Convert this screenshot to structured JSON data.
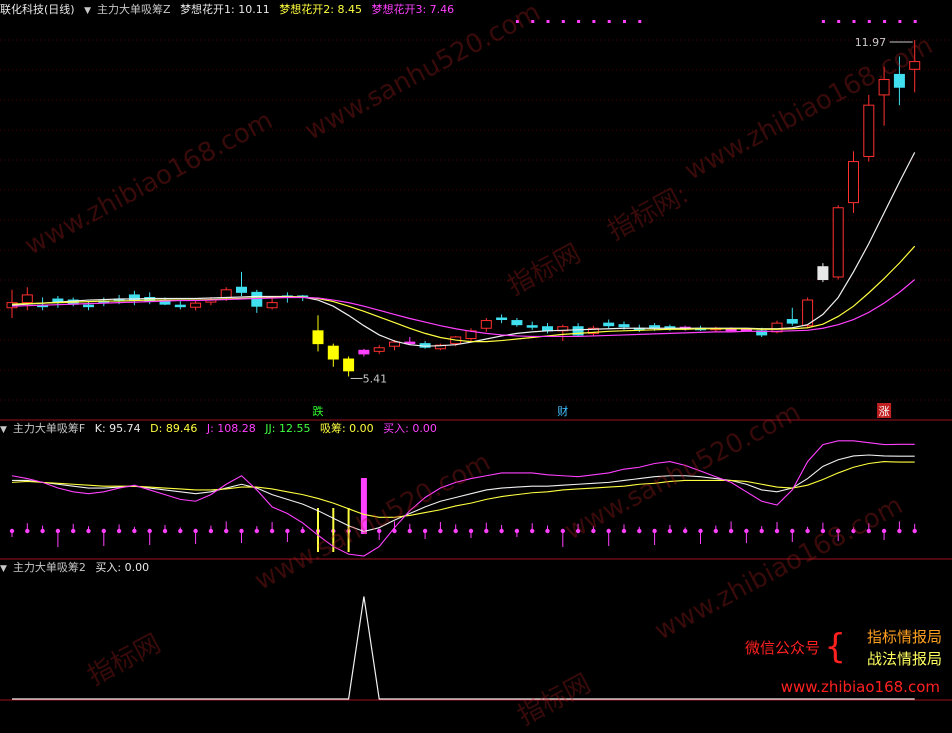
{
  "title_bar": {
    "stock": "联化科技(日线)",
    "indicator": "主力大单吸筹Z",
    "lines": [
      {
        "label": "梦想花开1: 10.11",
        "color": "#e8e8e8"
      },
      {
        "label": "梦想花开2: 8.45",
        "color": "#ffff40"
      },
      {
        "label": "梦想花开3: 7.46",
        "color": "#ff40ff"
      }
    ]
  },
  "pane2_title": {
    "indicator": "主力大单吸筹F",
    "items": [
      {
        "label": "K: 95.74",
        "color": "#e8e8e8"
      },
      {
        "label": "D: 89.46",
        "color": "#ffff40"
      },
      {
        "label": "J: 108.28",
        "color": "#ff40ff"
      },
      {
        "label": "JJ: 12.55",
        "color": "#40ff40"
      },
      {
        "label": "吸筹: 0.00",
        "color": "#ffff40"
      },
      {
        "label": "买入: 0.00",
        "color": "#ff40ff"
      }
    ]
  },
  "pane3_title": {
    "indicator": "主力大单吸筹2",
    "items": [
      {
        "label": "买入: 0.00",
        "color": "#e8e8e8"
      }
    ]
  },
  "promo": {
    "left": "微信公众号",
    "line1": "指标情报局",
    "line2": "战法情报局",
    "url": "www.zhibiao168.com"
  },
  "watermarks": [
    "www.zhibiao168.com",
    "www.sanhu520.com",
    "指标网",
    "指标网:",
    "www.zhibiao168.com",
    "www.sanhu520.com",
    "指标网",
    "www.zhibiao168.com",
    "www.sanhu520.com",
    "指标网"
  ],
  "chart_data": [
    {
      "type": "candlestick",
      "title": "主力大单吸筹Z",
      "ylim": [
        4.6,
        12.4
      ],
      "annotations": [
        {
          "text": "11.97",
          "index": 59,
          "value": 11.97
        },
        {
          "text": "5.41",
          "index": 22,
          "value": 5.41
        }
      ],
      "markers": [
        {
          "text": "跌",
          "index": 20,
          "color": "#30ff30"
        },
        {
          "text": "财",
          "index": 36,
          "color": "#40c0ff"
        },
        {
          "text": "涨",
          "index": 57,
          "color": "#ffffff",
          "bg": "#c02020"
        }
      ],
      "candles": [
        {
          "o": 6.75,
          "h": 7.1,
          "l": 6.55,
          "c": 6.85,
          "t": "r"
        },
        {
          "o": 6.85,
          "h": 7.15,
          "l": 6.7,
          "c": 7.0,
          "t": "r"
        },
        {
          "o": 6.8,
          "h": 6.95,
          "l": 6.7,
          "c": 6.8,
          "t": "c"
        },
        {
          "o": 6.85,
          "h": 6.98,
          "l": 6.75,
          "c": 6.92,
          "t": "c"
        },
        {
          "o": 6.9,
          "h": 6.95,
          "l": 6.78,
          "c": 6.82,
          "t": "c"
        },
        {
          "o": 6.78,
          "h": 6.88,
          "l": 6.7,
          "c": 6.8,
          "t": "c"
        },
        {
          "o": 6.85,
          "h": 6.95,
          "l": 6.78,
          "c": 6.88,
          "t": "c"
        },
        {
          "o": 6.92,
          "h": 7.0,
          "l": 6.82,
          "c": 6.9,
          "t": "c"
        },
        {
          "o": 6.9,
          "h": 7.08,
          "l": 6.8,
          "c": 7.0,
          "t": "c"
        },
        {
          "o": 6.95,
          "h": 7.05,
          "l": 6.82,
          "c": 6.88,
          "t": "c"
        },
        {
          "o": 6.88,
          "h": 6.95,
          "l": 6.8,
          "c": 6.82,
          "t": "c"
        },
        {
          "o": 6.8,
          "h": 6.9,
          "l": 6.72,
          "c": 6.78,
          "t": "c"
        },
        {
          "o": 6.76,
          "h": 6.88,
          "l": 6.7,
          "c": 6.84,
          "t": "r"
        },
        {
          "o": 6.86,
          "h": 6.96,
          "l": 6.8,
          "c": 6.9,
          "t": "r"
        },
        {
          "o": 6.95,
          "h": 7.15,
          "l": 6.88,
          "c": 7.1,
          "t": "r"
        },
        {
          "o": 7.05,
          "h": 7.45,
          "l": 6.98,
          "c": 7.15,
          "t": "c"
        },
        {
          "o": 7.05,
          "h": 7.1,
          "l": 6.65,
          "c": 6.78,
          "t": "c"
        },
        {
          "o": 6.85,
          "h": 6.95,
          "l": 6.72,
          "c": 6.75,
          "t": "r"
        },
        {
          "o": 6.95,
          "h": 7.05,
          "l": 6.85,
          "c": 6.98,
          "t": "c"
        },
        {
          "o": 6.98,
          "h": 7.0,
          "l": 6.88,
          "c": 6.95,
          "t": "c"
        },
        {
          "o": 6.3,
          "h": 6.6,
          "l": 5.9,
          "c": 6.05,
          "t": "y"
        },
        {
          "o": 6.0,
          "h": 6.05,
          "l": 5.6,
          "c": 5.75,
          "t": "y"
        },
        {
          "o": 5.75,
          "h": 5.8,
          "l": 5.41,
          "c": 5.52,
          "t": "y"
        },
        {
          "o": 5.85,
          "h": 5.95,
          "l": 5.8,
          "c": 5.92,
          "t": "m"
        },
        {
          "o": 5.9,
          "h": 6.02,
          "l": 5.85,
          "c": 5.97,
          "t": "r"
        },
        {
          "o": 6.0,
          "h": 6.12,
          "l": 5.92,
          "c": 6.08,
          "t": "r"
        },
        {
          "o": 6.08,
          "h": 6.18,
          "l": 6.02,
          "c": 6.06,
          "t": "m"
        },
        {
          "o": 6.05,
          "h": 6.1,
          "l": 5.95,
          "c": 5.98,
          "t": "c"
        },
        {
          "o": 5.95,
          "h": 6.05,
          "l": 5.92,
          "c": 6.02,
          "t": "r"
        },
        {
          "o": 6.05,
          "h": 6.2,
          "l": 6.0,
          "c": 6.18,
          "t": "r"
        },
        {
          "o": 6.15,
          "h": 6.35,
          "l": 6.1,
          "c": 6.3,
          "t": "r"
        },
        {
          "o": 6.35,
          "h": 6.55,
          "l": 6.28,
          "c": 6.5,
          "t": "r"
        },
        {
          "o": 6.55,
          "h": 6.62,
          "l": 6.45,
          "c": 6.55,
          "t": "c"
        },
        {
          "o": 6.5,
          "h": 6.55,
          "l": 6.38,
          "c": 6.42,
          "t": "c"
        },
        {
          "o": 6.4,
          "h": 6.48,
          "l": 6.32,
          "c": 6.38,
          "t": "c"
        },
        {
          "o": 6.38,
          "h": 6.45,
          "l": 6.25,
          "c": 6.3,
          "t": "c"
        },
        {
          "o": 6.3,
          "h": 6.42,
          "l": 6.1,
          "c": 6.38,
          "t": "r"
        },
        {
          "o": 6.38,
          "h": 6.45,
          "l": 6.2,
          "c": 6.22,
          "t": "c"
        },
        {
          "o": 6.25,
          "h": 6.4,
          "l": 6.2,
          "c": 6.35,
          "t": "r"
        },
        {
          "o": 6.4,
          "h": 6.52,
          "l": 6.35,
          "c": 6.45,
          "t": "c"
        },
        {
          "o": 6.42,
          "h": 6.48,
          "l": 6.32,
          "c": 6.38,
          "t": "c"
        },
        {
          "o": 6.35,
          "h": 6.42,
          "l": 6.28,
          "c": 6.32,
          "t": "c"
        },
        {
          "o": 6.35,
          "h": 6.45,
          "l": 6.3,
          "c": 6.4,
          "t": "c"
        },
        {
          "o": 6.38,
          "h": 6.42,
          "l": 6.3,
          "c": 6.34,
          "t": "c"
        },
        {
          "o": 6.35,
          "h": 6.4,
          "l": 6.3,
          "c": 6.37,
          "t": "m"
        },
        {
          "o": 6.34,
          "h": 6.4,
          "l": 6.3,
          "c": 6.35,
          "t": "c"
        },
        {
          "o": 6.33,
          "h": 6.38,
          "l": 6.28,
          "c": 6.35,
          "t": "r"
        },
        {
          "o": 6.33,
          "h": 6.37,
          "l": 6.3,
          "c": 6.32,
          "t": "m"
        },
        {
          "o": 6.32,
          "h": 6.36,
          "l": 6.3,
          "c": 6.33,
          "t": "m"
        },
        {
          "o": 6.3,
          "h": 6.36,
          "l": 6.18,
          "c": 6.22,
          "t": "c"
        },
        {
          "o": 6.28,
          "h": 6.5,
          "l": 6.25,
          "c": 6.45,
          "t": "r"
        },
        {
          "o": 6.45,
          "h": 6.75,
          "l": 6.4,
          "c": 6.52,
          "t": "c"
        },
        {
          "o": 6.4,
          "h": 6.95,
          "l": 6.35,
          "c": 6.9,
          "t": "r"
        },
        {
          "o": 7.3,
          "h": 7.62,
          "l": 7.25,
          "c": 7.55,
          "t": "w"
        },
        {
          "o": 7.35,
          "h": 8.75,
          "l": 7.3,
          "c": 8.7,
          "t": "r"
        },
        {
          "o": 8.8,
          "h": 9.8,
          "l": 8.6,
          "c": 9.6,
          "t": "r"
        },
        {
          "o": 9.7,
          "h": 10.9,
          "l": 9.6,
          "c": 10.7,
          "t": "r"
        },
        {
          "o": 10.9,
          "h": 11.45,
          "l": 10.3,
          "c": 11.2,
          "t": "r"
        },
        {
          "o": 11.05,
          "h": 11.65,
          "l": 10.7,
          "c": 11.3,
          "t": "c"
        },
        {
          "o": 11.4,
          "h": 11.97,
          "l": 10.95,
          "c": 11.55,
          "t": "r"
        }
      ],
      "series": [
        {
          "name": "梦想花开1",
          "values": [
            6.8,
            6.82,
            6.84,
            6.86,
            6.88,
            6.9,
            6.91,
            6.92,
            6.92,
            6.93,
            6.93,
            6.93,
            6.93,
            6.94,
            6.95,
            6.96,
            6.97,
            6.97,
            6.97,
            6.96,
            6.9,
            6.78,
            6.6,
            6.4,
            6.22,
            6.1,
            6.03,
            6.0,
            6.01,
            6.03,
            6.08,
            6.14,
            6.2,
            6.25,
            6.28,
            6.3,
            6.31,
            6.32,
            6.33,
            6.34,
            6.35,
            6.35,
            6.35,
            6.35,
            6.35,
            6.35,
            6.35,
            6.35,
            6.35,
            6.34,
            6.34,
            6.36,
            6.42,
            6.62,
            6.95,
            7.45,
            8.0,
            8.6,
            9.2,
            9.78
          ]
        },
        {
          "name": "梦想花开2",
          "values": [
            6.82,
            6.83,
            6.84,
            6.85,
            6.86,
            6.87,
            6.88,
            6.88,
            6.89,
            6.9,
            6.9,
            6.9,
            6.9,
            6.91,
            6.92,
            6.93,
            6.94,
            6.95,
            6.96,
            6.96,
            6.93,
            6.87,
            6.78,
            6.68,
            6.57,
            6.46,
            6.35,
            6.25,
            6.17,
            6.12,
            6.09,
            6.09,
            6.11,
            6.14,
            6.17,
            6.2,
            6.23,
            6.25,
            6.27,
            6.29,
            6.3,
            6.31,
            6.32,
            6.33,
            6.33,
            6.34,
            6.34,
            6.34,
            6.34,
            6.33,
            6.33,
            6.34,
            6.36,
            6.43,
            6.58,
            6.78,
            7.04,
            7.32,
            7.62,
            7.95
          ]
        },
        {
          "name": "梦想花开3",
          "values": [
            6.78,
            6.79,
            6.8,
            6.81,
            6.82,
            6.83,
            6.84,
            6.85,
            6.86,
            6.87,
            6.88,
            6.89,
            6.89,
            6.9,
            6.91,
            6.92,
            6.93,
            6.94,
            6.95,
            6.95,
            6.94,
            6.9,
            6.85,
            6.78,
            6.7,
            6.62,
            6.54,
            6.47,
            6.4,
            6.34,
            6.29,
            6.25,
            6.22,
            6.2,
            6.19,
            6.19,
            6.19,
            6.19,
            6.2,
            6.21,
            6.22,
            6.23,
            6.24,
            6.25,
            6.26,
            6.27,
            6.28,
            6.28,
            6.29,
            6.29,
            6.29,
            6.3,
            6.31,
            6.35,
            6.42,
            6.52,
            6.66,
            6.84,
            7.05,
            7.3
          ]
        }
      ]
    },
    {
      "type": "line",
      "title": "主力大单吸筹F",
      "ylim": [
        -10,
        115
      ],
      "series": [
        {
          "name": "K",
          "values": [
            70,
            70,
            68,
            66,
            64,
            62,
            62,
            63,
            64,
            62,
            60,
            58,
            56,
            58,
            62,
            66,
            62,
            55,
            50,
            45,
            38,
            30,
            22,
            16,
            20,
            28,
            35,
            42,
            48,
            52,
            56,
            60,
            62,
            63,
            64,
            64,
            65,
            66,
            67,
            68,
            70,
            72,
            74,
            75,
            75,
            74,
            72,
            70,
            66,
            60,
            58,
            62,
            72,
            85,
            92,
            96,
            97,
            96,
            95.74,
            95.74
          ]
        },
        {
          "name": "D",
          "values": [
            68,
            69,
            68,
            67,
            66,
            65,
            64,
            64,
            64,
            63,
            62,
            61,
            60,
            60,
            61,
            63,
            63,
            61,
            58,
            55,
            51,
            46,
            40,
            34,
            31,
            31,
            33,
            36,
            39,
            43,
            46,
            50,
            53,
            55,
            57,
            58,
            60,
            61,
            62,
            63,
            64,
            66,
            67,
            69,
            70,
            70,
            70,
            70,
            69,
            66,
            63,
            62,
            65,
            71,
            78,
            84,
            88,
            90,
            89.46,
            89.46
          ]
        },
        {
          "name": "J",
          "values": [
            75,
            72,
            68,
            62,
            58,
            56,
            58,
            62,
            65,
            60,
            55,
            50,
            48,
            55,
            66,
            75,
            60,
            42,
            35,
            25,
            12,
            0,
            -8,
            -10,
            0,
            20,
            38,
            52,
            62,
            68,
            72,
            75,
            78,
            78,
            78,
            76,
            75,
            74,
            76,
            78,
            82,
            84,
            88,
            90,
            86,
            80,
            74,
            68,
            58,
            48,
            44,
            60,
            90,
            108,
            112,
            112,
            110,
            108,
            108.28,
            108.28
          ]
        }
      ],
      "bars_magenta_index": 23,
      "bars_yellow_indices": [
        20,
        21,
        22
      ]
    },
    {
      "type": "line",
      "title": "主力大单吸筹2",
      "ylim": [
        0,
        1.2
      ],
      "series": [
        {
          "name": "买入",
          "values": [
            0,
            0,
            0,
            0,
            0,
            0,
            0,
            0,
            0,
            0,
            0,
            0,
            0,
            0,
            0,
            0,
            0,
            0,
            0,
            0,
            0,
            0,
            0,
            1,
            0,
            0,
            0,
            0,
            0,
            0,
            0,
            0,
            0,
            0,
            0,
            0,
            0,
            0,
            0,
            0,
            0,
            0,
            0,
            0,
            0,
            0,
            0,
            0,
            0,
            0,
            0,
            0,
            0,
            0,
            0,
            0,
            0,
            0,
            0,
            0
          ]
        }
      ]
    }
  ]
}
